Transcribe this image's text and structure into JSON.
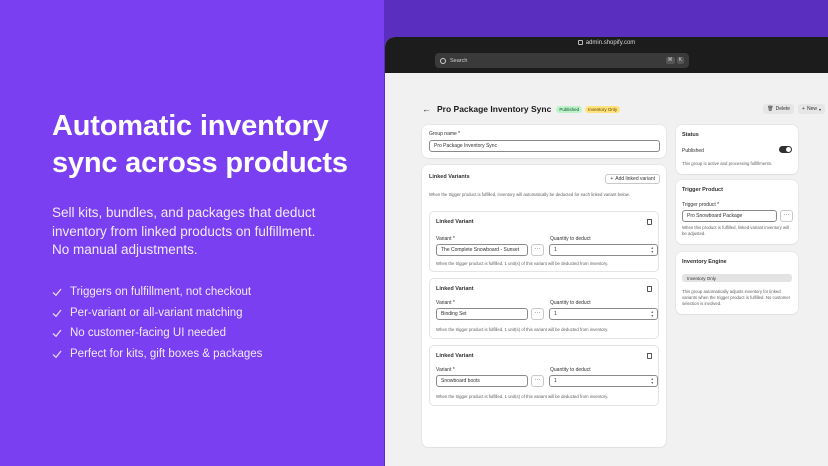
{
  "hero": {
    "headline_line1": "Automatic inventory",
    "headline_line2": "sync across products",
    "subtext_line1": "Sell kits, bundles, and packages that deduct",
    "subtext_line2": "inventory from linked products on fulfillment.",
    "subtext_line3": "No manual adjustments.",
    "bullets": [
      "Triggers on fulfillment, not checkout",
      "Per-variant or all-variant matching",
      "No customer-facing UI needed",
      "Perfect for kits, gift boxes & packages"
    ]
  },
  "browser": {
    "url": "admin.shopify.com",
    "search_placeholder": "Search",
    "shortcut_key1": "⌘",
    "shortcut_key2": "K"
  },
  "page": {
    "title": "Pro Package Inventory Sync",
    "badge_status": "Published",
    "badge_engine": "Inventory Only",
    "delete_label": "Delete",
    "new_label": "New"
  },
  "group": {
    "name_label": "Group name *",
    "name_value": "Pro Package Inventory Sync"
  },
  "linked": {
    "heading": "Linked Variants",
    "add_label": "Add linked variant",
    "desc": "When the trigger product is fulfilled, inventory will automatically be deducted for each linked variant below.",
    "variant_label": "Variant *",
    "qty_label": "Quantity to deduct",
    "items": [
      {
        "title": "Linked Variant",
        "variant": "The Complete Snowboard - Sunset",
        "qty": "1",
        "note": "When the trigger product is fulfilled, 1 unit(s) of this variant will be deducted from inventory."
      },
      {
        "title": "Linked Variant",
        "variant": "Binding Set",
        "qty": "1",
        "note": "When the trigger product is fulfilled, 1 unit(s) of this variant will be deducted from inventory."
      },
      {
        "title": "Linked Variant",
        "variant": "Snowboard boots",
        "qty": "1",
        "note": "When the trigger product is fulfilled, 1 unit(s) of this variant will be deducted from inventory."
      }
    ]
  },
  "status": {
    "heading": "Status",
    "label": "Published",
    "enabled": true,
    "desc": "This group is active and processing fulfillments."
  },
  "trigger": {
    "heading": "Trigger Product",
    "label": "Trigger product *",
    "value": "Pro Snowboard Package",
    "desc": "When this product is fulfilled, linked variant inventory will be adjusted."
  },
  "engine": {
    "heading": "Inventory Engine",
    "value": "Inventory Only",
    "desc": "This group automatically adjusts inventory for linked variants when the trigger product is fulfilled. No customer selection is involved."
  },
  "colors": {
    "brand_purple": "#7B3FF2",
    "published_green": "#bdf2c8",
    "engine_yellow": "#ffe27a"
  }
}
